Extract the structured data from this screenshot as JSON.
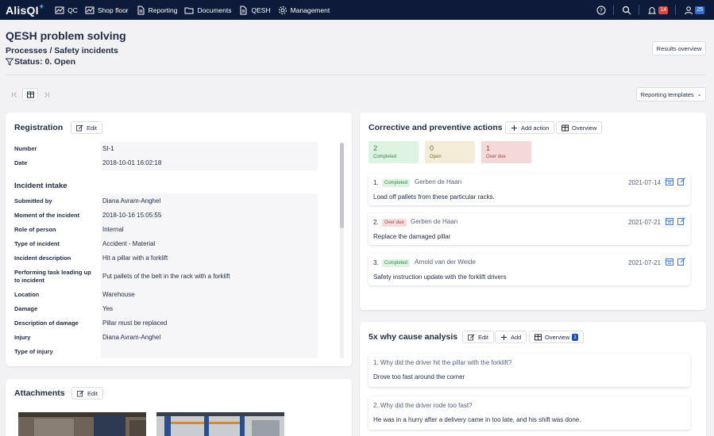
{
  "app": {
    "logo_text": "AlisQI",
    "logo_plus": "+"
  },
  "nav": [
    {
      "label": "QC",
      "icon": "chart-icon"
    },
    {
      "label": "Shop floor",
      "icon": "chart-icon"
    },
    {
      "label": "Reporting",
      "icon": "document-icon"
    },
    {
      "label": "Documents",
      "icon": "folder-icon"
    },
    {
      "label": "QESH",
      "icon": "document-icon"
    },
    {
      "label": "Management",
      "icon": "gear-icon"
    }
  ],
  "topbar_right": {
    "notifications_count": "14",
    "users_count": "25"
  },
  "page": {
    "title": "QESH problem solving",
    "breadcrumb": "Processes / Safety incidents",
    "status": "Status: 0. Open",
    "results_overview": "Results overview",
    "reporting_templates": "Reporting templates"
  },
  "registration": {
    "title": "Registration",
    "edit": "Edit",
    "top_fields": [
      {
        "label": "Number",
        "value": "SI-1"
      },
      {
        "label": "Date",
        "value": "2018-10-01 16:02:18"
      }
    ],
    "intake_title": "Incident intake",
    "intake_fields": [
      {
        "label": "Submitted by",
        "value": "Diana Avram-Anghel"
      },
      {
        "label": "Moment of the incident",
        "value": "2018-10-16 15:05:55"
      },
      {
        "label": "Role of person",
        "value": "Internal"
      },
      {
        "label": "Type of incident",
        "value": "Accident - Material"
      },
      {
        "label": "Incident description",
        "value": "Hit a pillar with a forklift"
      },
      {
        "label": "Performing task leading up",
        "label2": "to incident",
        "value": "Put pallets of the belt in the rack with a forklift"
      },
      {
        "label": "Location",
        "value": "Warehouse"
      },
      {
        "label": "Damage",
        "value": "Yes"
      },
      {
        "label": "Description of damage",
        "value": "Pillar must be replaced"
      },
      {
        "label": "Injury",
        "value": "Diana Avram-Anghel"
      },
      {
        "label": "Type of injury",
        "value": ""
      }
    ]
  },
  "attachments": {
    "title": "Attachments",
    "edit": "Edit"
  },
  "capa": {
    "title": "Corrective and preventive actions",
    "add_action": "Add action",
    "overview": "Overview",
    "stats": [
      {
        "value": "2",
        "label": "Completed",
        "color": "#dff3e3"
      },
      {
        "value": "0",
        "label": "Open",
        "color": "#f4ecd6"
      },
      {
        "value": "1",
        "label": "Over due",
        "color": "#f4d9d9"
      }
    ],
    "actions": [
      {
        "num": "1.",
        "status": "Completed",
        "owner": "Gerben de Haan",
        "date": "2021-07-14",
        "desc": "Load off pallets from these particular racks."
      },
      {
        "num": "2.",
        "status": "Over due",
        "owner": "Gerben de Haan",
        "date": "2021-07-21",
        "desc": "Replace the damaged pillar"
      },
      {
        "num": "3.",
        "status": "Completed",
        "owner": "Arnold van der Weide",
        "date": "2021-07-21",
        "desc": "Safety instruction update with the forklift drivers"
      }
    ]
  },
  "why": {
    "title": "5x why cause analysis",
    "edit": "Edit",
    "add": "Add",
    "overview": "Overview",
    "overview_count": "1",
    "items": [
      {
        "q": "1. Why did the driver hit the pillar with the forklift?",
        "a": "Drove too fast around the corner"
      },
      {
        "q": "2. Why did the driver rode too fast?",
        "a": "He was in a hurry after a delivery came in too late, and his shift was done."
      }
    ]
  }
}
